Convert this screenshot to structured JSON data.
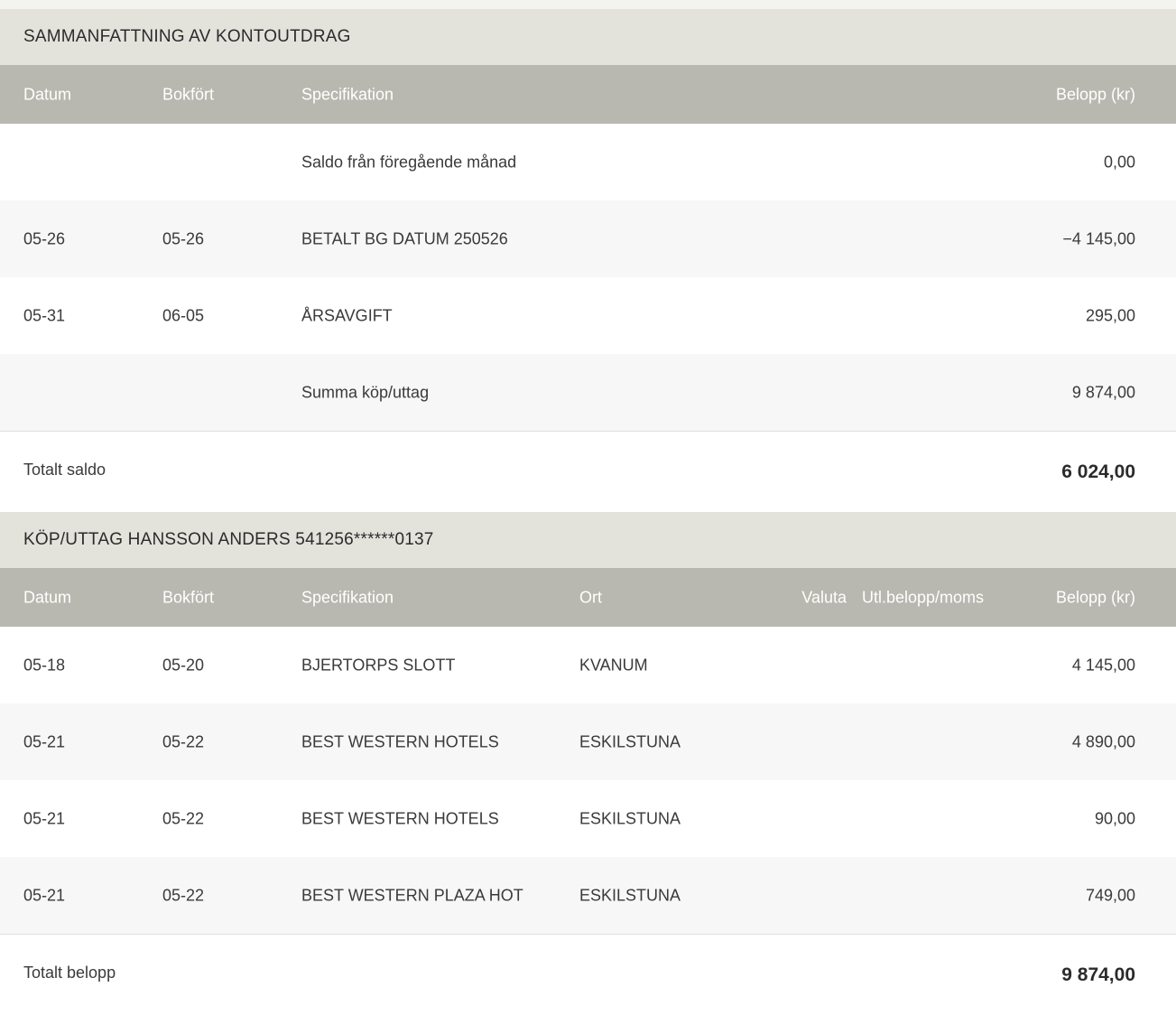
{
  "summary": {
    "title": "SAMMANFATTNING AV KONTOUTDRAG",
    "headers": {
      "datum": "Datum",
      "bokfort": "Bokfört",
      "spec": "Specifikation",
      "belopp": "Belopp (kr)"
    },
    "rows": [
      {
        "datum": "",
        "bokfort": "",
        "spec": "Saldo från föregående månad",
        "belopp": "0,00"
      },
      {
        "datum": "05-26",
        "bokfort": "05-26",
        "spec": "BETALT BG DATUM 250526",
        "belopp": "−4 145,00"
      },
      {
        "datum": "05-31",
        "bokfort": "06-05",
        "spec": "ÅRSAVGIFT",
        "belopp": "295,00"
      },
      {
        "datum": "",
        "bokfort": "",
        "spec": "Summa köp/uttag",
        "belopp": "9 874,00"
      }
    ],
    "total_label": "Totalt saldo",
    "total_value": "6 024,00"
  },
  "purchases": {
    "title": "KÖP/UTTAG HANSSON ANDERS 541256******0137",
    "headers": {
      "datum": "Datum",
      "bokfort": "Bokfört",
      "spec": "Specifikation",
      "ort": "Ort",
      "valuta": "Valuta",
      "utl": "Utl.belopp/moms",
      "belopp": "Belopp (kr)"
    },
    "rows": [
      {
        "datum": "05-18",
        "bokfort": "05-20",
        "spec": "BJERTORPS SLOTT",
        "ort": "KVANUM",
        "belopp": "4 145,00"
      },
      {
        "datum": "05-21",
        "bokfort": "05-22",
        "spec": "BEST WESTERN HOTELS",
        "ort": "ESKILSTUNA",
        "belopp": "4 890,00"
      },
      {
        "datum": "05-21",
        "bokfort": "05-22",
        "spec": "BEST WESTERN HOTELS",
        "ort": "ESKILSTUNA",
        "belopp": "90,00"
      },
      {
        "datum": "05-21",
        "bokfort": "05-22",
        "spec": "BEST WESTERN PLAZA HOT",
        "ort": "ESKILSTUNA",
        "belopp": "749,00"
      }
    ],
    "total_label": "Totalt belopp",
    "total_value": "9 874,00"
  }
}
